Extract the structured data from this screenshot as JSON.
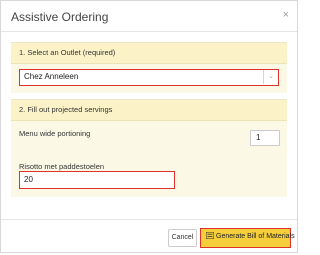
{
  "dialog": {
    "title": "Assistive Ordering",
    "close_glyph": "×"
  },
  "outlet_section": {
    "header": "1. Select an Outlet (required)",
    "selected_outlet": "Chez Anneleen",
    "caret_glyph": "⌄"
  },
  "servings_section": {
    "header": "2. Fill out projected servings",
    "menu_wide_label": "Menu wide portioning",
    "menu_wide_value": "1",
    "item_label": "Risotto met paddestoelen",
    "item_value": "20"
  },
  "footer": {
    "cancel_label": "Cancel",
    "generate_label": "Generate Bill of Materials",
    "generate_icon": "list-icon"
  },
  "colors": {
    "highlight_border": "#e0322a",
    "section_header_bg": "#fbf3c7",
    "section_bg": "#fbf9e6",
    "primary_button_bg": "#f4cf3b"
  }
}
